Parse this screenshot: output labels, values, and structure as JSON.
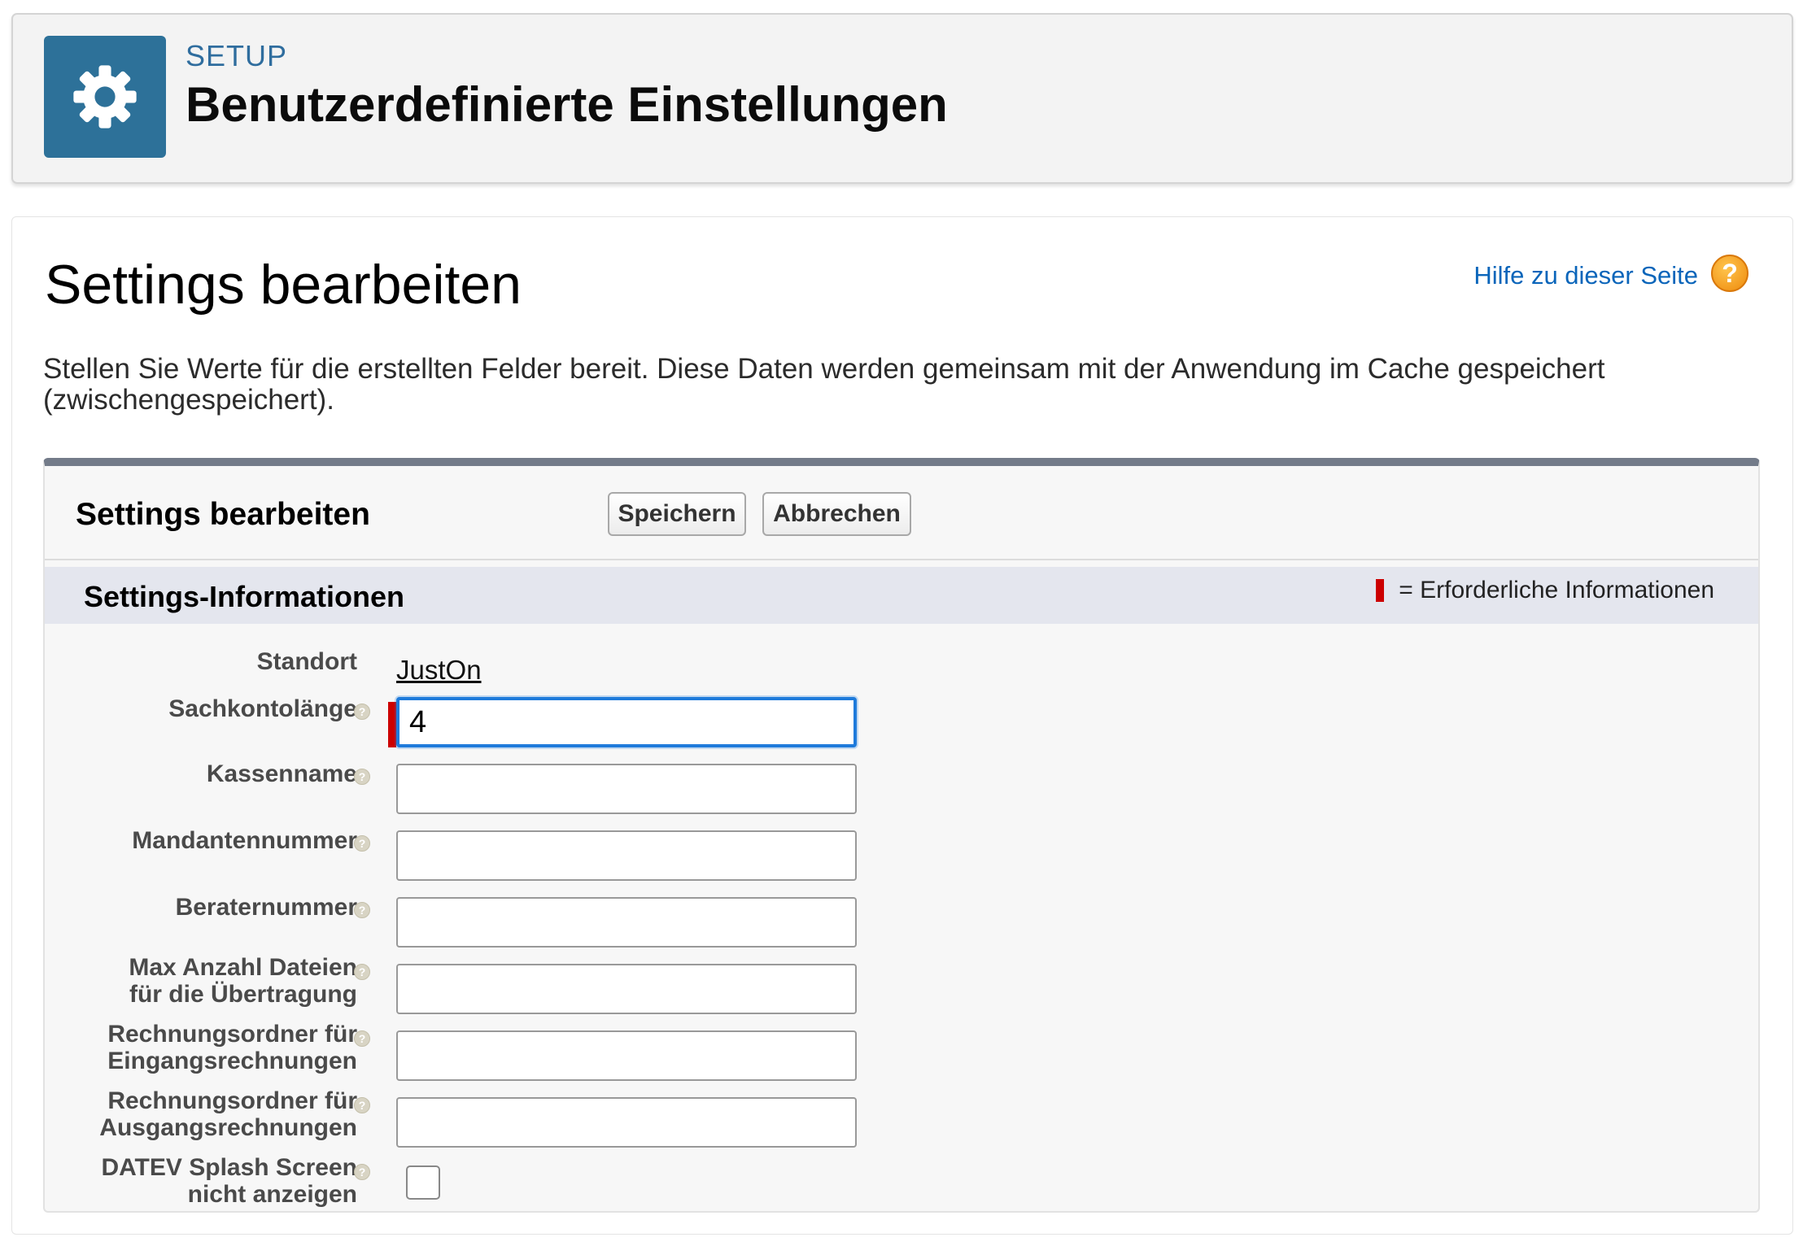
{
  "header": {
    "eyebrow": "SETUP",
    "title": "Benutzerdefinierte Einstellungen",
    "icon": "gear-icon",
    "icon_bg": "#2d7199"
  },
  "page": {
    "title": "Settings bearbeiten",
    "help_link": "Hilfe zu dieser Seite",
    "help_icon": "?",
    "description": "Stellen Sie Werte für die erstellten Felder bereit. Diese Daten werden gemeinsam mit der Anwendung im Cache gespeichert (zwischengespeichert)."
  },
  "edit": {
    "title": "Settings bearbeiten",
    "save_label": "Speichern",
    "cancel_label": "Abbrechen",
    "section_title": "Settings-Informationen",
    "required_legend": "= Erforderliche Informationen"
  },
  "fields": {
    "standort": {
      "label": "Standort",
      "value": "JustOn"
    },
    "sachkontolaenge": {
      "label": "Sachkontolänge",
      "value": "4",
      "required": true
    },
    "kassenname": {
      "label": "Kassenname",
      "value": ""
    },
    "mandantennummer": {
      "label": "Mandantennummer",
      "value": ""
    },
    "beraternummer": {
      "label": "Beraternummer",
      "value": ""
    },
    "max_dateien": {
      "label_line1": "Max Anzahl Dateien",
      "label_line2": "für die Übertragung",
      "value": ""
    },
    "ordner_eingang": {
      "label_line1": "Rechnungsordner für",
      "label_line2": "Eingangsrechnungen",
      "value": ""
    },
    "ordner_ausgang": {
      "label_line1": "Rechnungsordner für",
      "label_line2": "Ausgangsrechnungen",
      "value": ""
    },
    "datev_splash": {
      "label_line1": "DATEV Splash Screen",
      "label_line2": "nicht anzeigen",
      "checked": false
    }
  },
  "colors": {
    "accent": "#2d7199",
    "link": "#0a65ba",
    "required": "#cc0000",
    "focus": "#1f7bdb"
  }
}
